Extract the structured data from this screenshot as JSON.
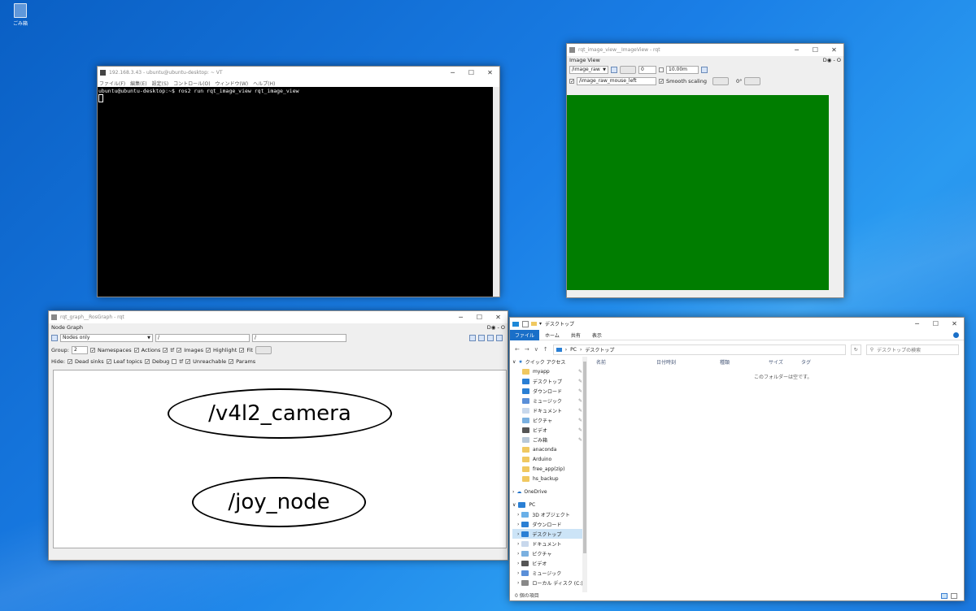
{
  "desktop": {
    "recycle_bin_label": "ごみ箱"
  },
  "terminal": {
    "title": "192.168.3.43 - ubuntu@ubuntu-desktop: ~ VT",
    "menu": [
      "ファイル(F)",
      "編集(E)",
      "設定(S)",
      "コントロール(O)",
      "ウィンドウ(W)",
      "ヘルプ(H)"
    ],
    "prompt_line": "ubuntu@ubuntu-desktop:~$ ros2 run rqt_image_view rqt_image_view"
  },
  "image_view": {
    "title": "rqt_image_view__ImageView - rqt",
    "plugin_name": "Image View",
    "plugin_ctl": "D◉ - O",
    "topic": "/image_raw",
    "spin_value": "0",
    "max_range": "10.00m",
    "mouse_topic": "/image_raw_mouse_left",
    "smooth_label": "Smooth scaling",
    "rotation": "0°",
    "image_color": "#007d00"
  },
  "graph": {
    "title": "rqt_graph__RosGraph - rqt",
    "plugin_name": "Node Graph",
    "plugin_ctl": "D◉ - O",
    "mode": "Nodes only",
    "filter1": "/",
    "filter2": "/",
    "group_label": "Group:",
    "group_value": "2",
    "opts": [
      "Namespaces",
      "Actions",
      "tf",
      "Images",
      "Highlight",
      "Fit"
    ],
    "hide_label": "Hide:",
    "hide_opts": [
      "Dead sinks",
      "Leaf topics",
      "Debug",
      "tf",
      "Unreachable",
      "Params"
    ],
    "nodes": [
      "/v4l2_camera",
      "/joy_node"
    ]
  },
  "explorer": {
    "title": "デスクトップ",
    "ribbon_tabs": [
      "ファイル",
      "ホーム",
      "共有",
      "表示"
    ],
    "path": [
      "PC",
      "デスクトップ"
    ],
    "search_placeholder": "デスクトップの検索",
    "columns": [
      "名前",
      "日付時刻",
      "種類",
      "サイズ",
      "タグ"
    ],
    "empty_msg": "このフォルダーは空です。",
    "quick_access": "クイック アクセス",
    "quick_items": [
      "myapp",
      "デスクトップ",
      "ダウンロード",
      "ミュージック",
      "ドキュメント",
      "ピクチャ",
      "ビデオ",
      "ごみ箱",
      "anaconda",
      "Arduino",
      "free_app(zip)",
      "hs_backup"
    ],
    "onedrive": "OneDrive",
    "pc": "PC",
    "pc_items": [
      "3D オブジェクト",
      "ダウンロード",
      "デスクトップ",
      "ドキュメント",
      "ピクチャ",
      "ビデオ",
      "ミュージック",
      "ローカル ディスク (C:)"
    ],
    "status": "0 個の項目"
  }
}
